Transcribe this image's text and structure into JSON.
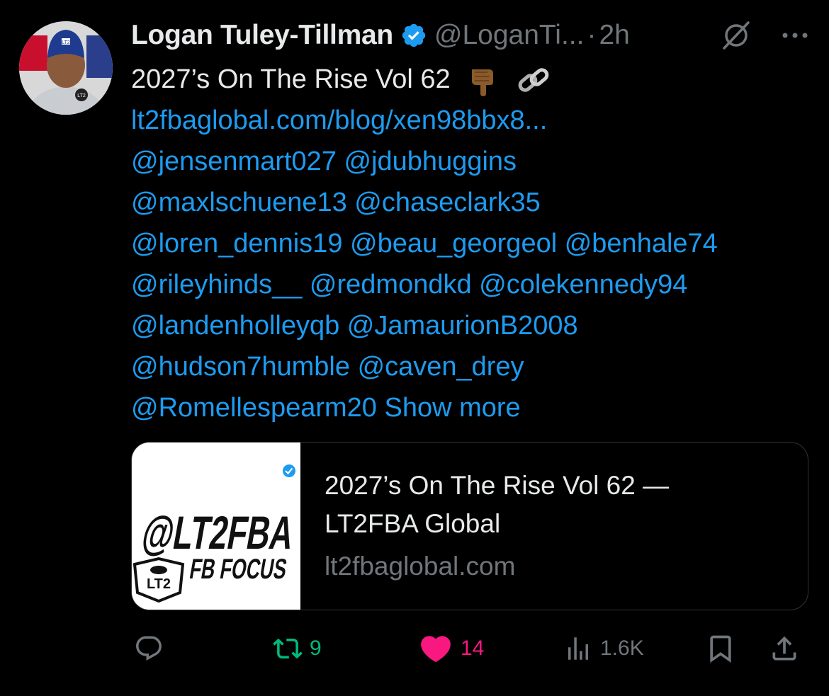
{
  "author": {
    "name": "Logan Tuley-Tillman",
    "handle": "@LoganTi...",
    "separator": "·",
    "time": "2h",
    "avatar_cap_text": "LT2",
    "avatar_shirt_text": "LT2"
  },
  "tweet": {
    "headline": "2027’s On The Rise Vol 62",
    "link": "lt2fbaglobal.com/blog/xen98bbx8...",
    "mention_lines": [
      "@jensenmart027 @jdubhuggins",
      "@maxlschuene13 @chaseclark35",
      "@loren_dennis19 @beau_georgeol @benhale74",
      "@rileyhinds__ @redmondkd @colekennedy94",
      "@landenholleyqb @JamaurionB2008",
      "@hudson7humble @caven_drey"
    ],
    "last_mention": "@Romellespearm20",
    "show_more": "Show more"
  },
  "card": {
    "image_text_1": "@LT2FBA",
    "image_text_2": "FB FOCUS",
    "image_badge": "LT2",
    "title_line1": "2027’s On The Rise Vol 62 —",
    "title_line2": "LT2FBA Global",
    "domain": "lt2fbaglobal.com"
  },
  "actions": {
    "replies": "",
    "reposts": "9",
    "likes": "14",
    "views": "1.6K"
  },
  "colors": {
    "background": "#000000",
    "link": "#1d9bf0",
    "muted": "#71767b",
    "repost": "#00ba7c",
    "like": "#f91880",
    "verified": "#1d9bf0"
  },
  "icons": [
    "verified-badge-icon",
    "grok-icon",
    "more-icon",
    "pointing-down-emoji-icon",
    "link-emoji-icon",
    "reply-icon",
    "repost-icon",
    "like-icon",
    "views-icon",
    "bookmark-icon",
    "share-icon"
  ]
}
